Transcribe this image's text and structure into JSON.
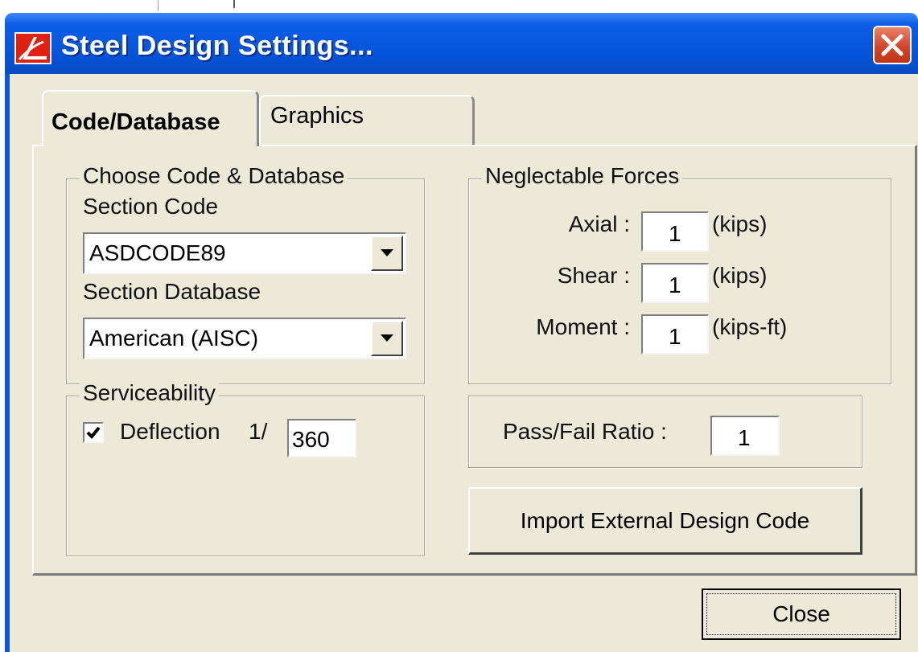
{
  "window": {
    "title": "Steel Design Settings...",
    "app_icon": "logo-icon",
    "close_icon": "close-icon"
  },
  "tabs": [
    {
      "label": "Code/Database",
      "selected": true
    },
    {
      "label": "Graphics",
      "selected": false
    }
  ],
  "code_database": {
    "legend": "Choose Code & Database",
    "section_code_label": "Section Code",
    "section_code_value": "ASDCODE89",
    "section_database_label": "Section Database",
    "section_database_value": "American (AISC)"
  },
  "neglectable_forces": {
    "legend": "Neglectable  Forces",
    "axial": {
      "label": "Axial :",
      "value": "1",
      "unit": "(kips)"
    },
    "shear": {
      "label": "Shear :",
      "value": "1",
      "unit": "(kips)"
    },
    "moment": {
      "label": "Moment :",
      "value": "1",
      "unit": "(kips-ft)"
    }
  },
  "serviceability": {
    "legend": "Serviceability",
    "deflection_label": "Deflection",
    "deflection_checked": true,
    "ratio_prefix": "1/",
    "ratio_value": "360"
  },
  "pass_fail": {
    "label": "Pass/Fail Ratio :",
    "value": "1"
  },
  "buttons": {
    "import_label": "Import External Design Code",
    "close_label": "Close"
  },
  "colors": {
    "titlebar": "#0553d8",
    "dialog_face": "#ece9d8",
    "close_button": "#d2452a"
  }
}
